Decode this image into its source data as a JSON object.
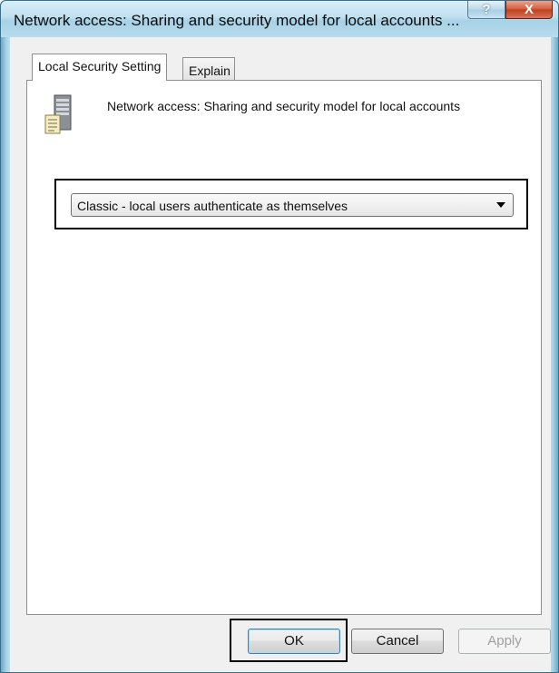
{
  "window": {
    "title": "Network access: Sharing and security model for local accounts ...",
    "help_button": "?",
    "close_button": "X"
  },
  "tabs": [
    {
      "label": "Local Security Setting",
      "active": true
    },
    {
      "label": "Explain",
      "active": false
    }
  ],
  "panel": {
    "icon": "server-policy-icon",
    "description": "Network access: Sharing and security model for local accounts",
    "dropdown": {
      "selected": "Classic - local users authenticate as themselves"
    }
  },
  "buttons": {
    "ok": "OK",
    "cancel": "Cancel",
    "apply": "Apply"
  },
  "colors": {
    "annotation_border": "#000000",
    "disabled_text": "#a0a0a0"
  }
}
